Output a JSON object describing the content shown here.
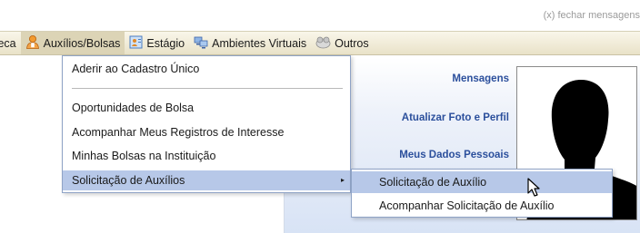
{
  "top_notice": "(x) fechar mensagens",
  "menubar": {
    "items": [
      {
        "label": "teca",
        "icon": "none"
      },
      {
        "label": "Auxílios/Bolsas",
        "icon": "user-icon"
      },
      {
        "label": "Estágio",
        "icon": "document-icon"
      },
      {
        "label": "Ambientes Virtuais",
        "icon": "network-icon"
      },
      {
        "label": "Outros",
        "icon": "other-icon"
      }
    ]
  },
  "dropdown": {
    "items": [
      {
        "label": "Aderir ao Cadastro Único"
      },
      {
        "label": "Oportunidades de Bolsa"
      },
      {
        "label": "Acompanhar Meus Registros de Interesse"
      },
      {
        "label": "Minhas Bolsas na Instituição"
      },
      {
        "label": "Solicitação de Auxílios",
        "submenu_arrow": "▸"
      }
    ]
  },
  "submenu": {
    "items": [
      {
        "label": "Solicitação de Auxílio"
      },
      {
        "label": "Acompanhar Solicitação de Auxílio"
      }
    ]
  },
  "side_panel": {
    "links": [
      "Mensagens",
      "Atualizar Foto e Perfil",
      "Meus Dados Pessoais"
    ]
  },
  "colors": {
    "menubar_bg": "#ece6cf",
    "highlight": "#b7c8e8",
    "panel_link": "#2b4f9c"
  }
}
